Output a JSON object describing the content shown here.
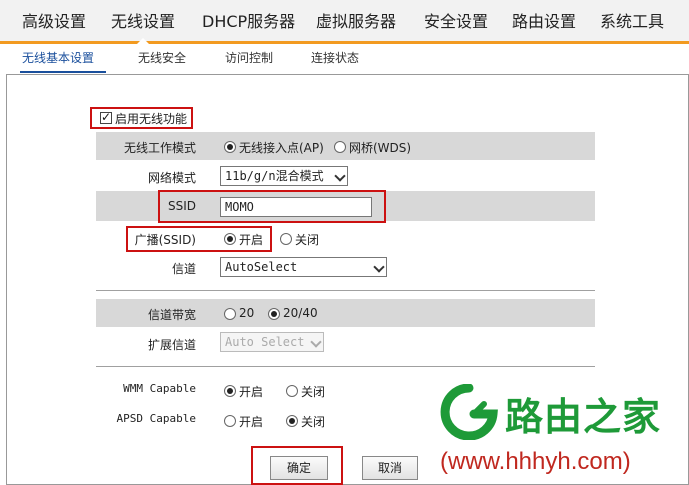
{
  "topnav": {
    "items": [
      "高级设置",
      "无线设置",
      "DHCP服务器",
      "虚拟服务器",
      "安全设置",
      "路由设置",
      "系统工具"
    ],
    "active_index": 1,
    "accent_color": "#f29a20"
  },
  "subnav": {
    "items": [
      "无线基本设置",
      "无线安全",
      "访问控制",
      "连接状态"
    ],
    "active_index": 0
  },
  "form": {
    "enable_wireless": {
      "label": "启用无线功能",
      "checked": true
    },
    "mode": {
      "label": "无线工作模式",
      "options": [
        "无线接入点(AP)",
        "网桥(WDS)"
      ],
      "selected": "无线接入点(AP)"
    },
    "network_mode": {
      "label": "网络模式",
      "value": "11b/g/n混合模式"
    },
    "ssid": {
      "label": "SSID",
      "value": "MOMO"
    },
    "broadcast": {
      "label": "广播(SSID)",
      "options": [
        "开启",
        "关闭"
      ],
      "selected": "开启"
    },
    "channel": {
      "label": "信道",
      "value": "AutoSelect"
    },
    "bandwidth": {
      "label": "信道带宽",
      "options": [
        "20",
        "20/40"
      ],
      "selected": "20/40"
    },
    "ext_channel": {
      "label": "扩展信道",
      "value": "Auto Select",
      "disabled": true
    },
    "wmm": {
      "label": "WMM Capable",
      "options": [
        "开启",
        "关闭"
      ],
      "selected": "开启"
    },
    "apsd": {
      "label": "APSD Capable",
      "options": [
        "开启",
        "关闭"
      ],
      "selected": "关闭"
    }
  },
  "buttons": {
    "ok": "确定",
    "cancel": "取消"
  },
  "watermark": {
    "brand": "路由之家",
    "url": "(www.hhhyh.com)",
    "brand_color": "#1e9a38",
    "url_color": "#c0281f"
  },
  "highlight_color": "#cc1111"
}
